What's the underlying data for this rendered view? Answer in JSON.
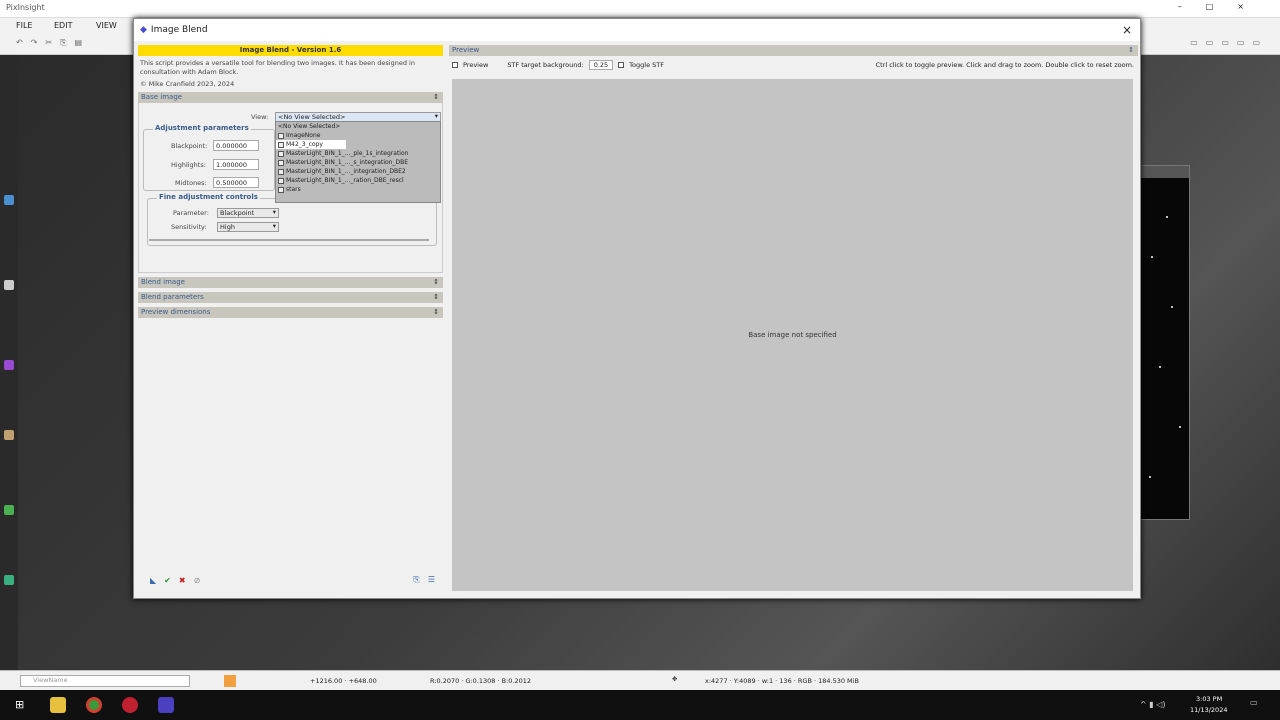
{
  "app": {
    "title": "PixInsight",
    "menu": [
      "FILE",
      "EDIT",
      "VIEW"
    ]
  },
  "dialog": {
    "title": "Image Blend",
    "close": "×",
    "banner": "Image Blend - Version 1.6",
    "description": "This script provides a versatile tool for blending two images. It has been designed in consultation with Adam Block.",
    "copyright": "© Mike Cranfield 2023, 2024",
    "sections": {
      "base": "Base image",
      "blend": "Blend image",
      "params": "Blend parameters",
      "preview_dims": "Preview dimensions"
    },
    "view_label": "View:",
    "view_value": "<No View Selected>",
    "view_options": [
      "<No View Selected>",
      "ImageNone",
      "M42_3_copy",
      "MasterLight_BIN_1_..._ple_1s_integration",
      "MasterLight_BIN_1_..._s_integration_DBE",
      "MasterLight_BIN_1_..._integration_DBE2",
      "MasterLight_BIN_1_..._ration_DBE_rescl",
      "stars"
    ],
    "adjust": {
      "title": "Adjustment parameters",
      "blackpoint_label": "Blackpoint:",
      "blackpoint": "0.000000",
      "highlights_label": "Highlights:",
      "highlights": "1.000000",
      "midtones_label": "Midtones:",
      "midtones": "0.500000"
    },
    "fine": {
      "title": "Fine adjustment controls",
      "parameter_label": "Parameter:",
      "parameter": "Blackpoint",
      "sensitivity_label": "Sensitivity:",
      "sensitivity": "High"
    },
    "preview": {
      "header": "Preview",
      "checkbox": "Preview",
      "stf_label": "STF target background:",
      "stf_value": "0.25",
      "toggle_stf": "Toggle STF",
      "hint": "Ctrl click to toggle preview. Click and drag to zoom. Double click to reset zoom.",
      "empty": "Base image not specified"
    }
  },
  "status": {
    "view": "ViewName",
    "coords": "+1216.00 · +648.00",
    "rgb": "R:0.2070 · G:0.1308 · B:0.2012",
    "info": "x:4277 · Y:4089 · w:1 · 136 · RGB · 184.530 MiB"
  },
  "taskbar": {
    "time": "3:03 PM",
    "date": "11/13/2024"
  }
}
